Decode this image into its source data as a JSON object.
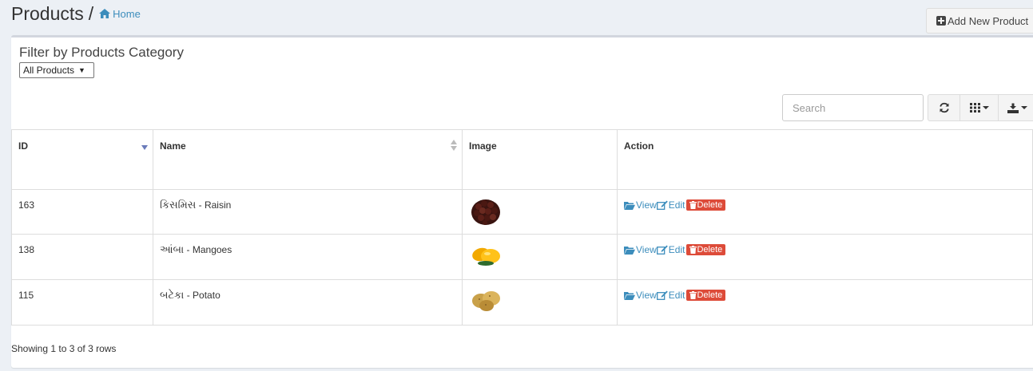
{
  "header": {
    "title": "Products",
    "separator": "/",
    "breadcrumb_home": "Home",
    "add_button": "Add New Product"
  },
  "filter": {
    "title": "Filter by Products Category",
    "selected": "All Products"
  },
  "search": {
    "placeholder": "Search"
  },
  "table": {
    "columns": [
      "ID",
      "Name",
      "Image",
      "Action"
    ],
    "rows": [
      {
        "id": "163",
        "name_local": "કિસમિસ",
        "name_sep": " - ",
        "name_en": "Raisin",
        "image": "raisin"
      },
      {
        "id": "138",
        "name_local": "આંબા",
        "name_sep": " - ",
        "name_en": "Mangoes",
        "image": "mango"
      },
      {
        "id": "115",
        "name_local": "બટેકા",
        "name_sep": " - ",
        "name_en": "Potato",
        "image": "potato"
      }
    ],
    "actions": {
      "view": "View",
      "edit": "Edit",
      "delete": "Delete"
    }
  },
  "footer": {
    "info": "Showing 1 to 3 of 3 rows"
  },
  "colors": {
    "link": "#3c8dbc",
    "danger": "#dd4b39",
    "sort_indicator": "#6a7bba"
  },
  "icons": [
    "home-icon",
    "plus-square-icon",
    "refresh-icon",
    "columns-icon",
    "export-icon",
    "folder-open-icon",
    "edit-icon",
    "trash-icon"
  ]
}
